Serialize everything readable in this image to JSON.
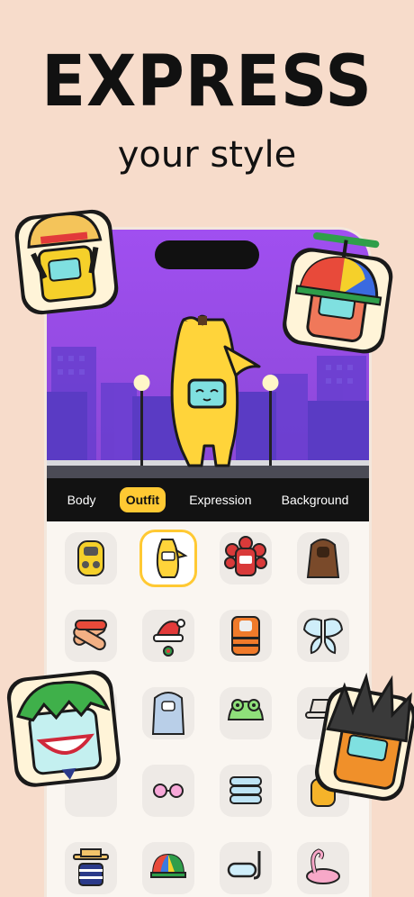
{
  "hero": {
    "title": "EXPRESS",
    "subtitle": "your style"
  },
  "tabs": [
    {
      "label": "Body",
      "active": false
    },
    {
      "label": "Outfit",
      "active": true
    },
    {
      "label": "Expression",
      "active": false
    },
    {
      "label": "Background",
      "active": false
    }
  ],
  "outfit_items": [
    {
      "name": "hazmat-suit-icon",
      "selected": false
    },
    {
      "name": "banana-costume-icon",
      "selected": true
    },
    {
      "name": "flower-monster-icon",
      "selected": false
    },
    {
      "name": "hooded-cloak-icon",
      "selected": false
    },
    {
      "name": "goggles-bandage-icon",
      "selected": false
    },
    {
      "name": "santa-hat-icon",
      "selected": false
    },
    {
      "name": "life-vest-icon",
      "selected": false
    },
    {
      "name": "fairy-wings-icon",
      "selected": false
    },
    {
      "name": "yeti-costume-icon",
      "selected": false
    },
    {
      "name": "frog-hat-icon",
      "selected": false
    },
    {
      "name": "round-glasses-icon",
      "selected": false
    },
    {
      "name": "folded-towels-icon",
      "selected": false
    },
    {
      "name": "boater-hat-icon",
      "selected": false
    },
    {
      "name": "rainbow-cap-icon",
      "selected": false
    },
    {
      "name": "snorkel-mask-icon",
      "selected": false
    },
    {
      "name": "flamingo-float-icon",
      "selected": false
    }
  ],
  "colors": {
    "background": "#f7dccb",
    "accent": "#ffc933",
    "scene_sky": "#9a4fe0",
    "tabbar": "#121212"
  }
}
